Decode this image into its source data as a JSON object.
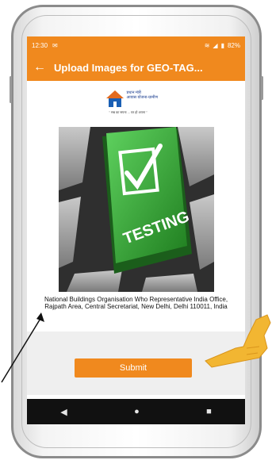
{
  "statusbar": {
    "time": "12:30",
    "battery": "82%"
  },
  "appbar": {
    "title": "Upload Images for GEO-TAG..."
  },
  "logo": {
    "line1": "प्रधान मंत्री",
    "line2": "आवास योजना-ग्रामीण",
    "tagline": "\" सब का सपना ... घर हो अपना \""
  },
  "photo": {
    "label": "TESTING"
  },
  "location": {
    "caption": "National Buildings Organisation Who Representative India Office, Rajpath Area, Central Secretariat, New Delhi, Delhi 110011, India"
  },
  "form": {
    "submit_label": "Submit"
  },
  "colors": {
    "accent": "#f0891e"
  },
  "icons": [
    "back-arrow-icon",
    "nav-back-icon",
    "nav-home-icon",
    "nav-recents-icon",
    "wifi-icon",
    "signal-icon",
    "battery-icon",
    "checkmark-icon"
  ]
}
